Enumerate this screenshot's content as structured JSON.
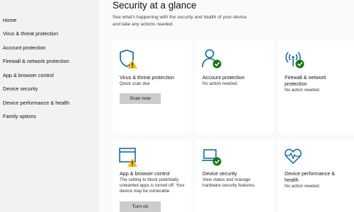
{
  "sidebar": {
    "items": [
      {
        "label": "Home"
      },
      {
        "label": "Virus & threat protection"
      },
      {
        "label": "Account protection"
      },
      {
        "label": "Firewall & network protection"
      },
      {
        "label": "App & browser control"
      },
      {
        "label": "Device security"
      },
      {
        "label": "Device performance & health"
      },
      {
        "label": "Family options"
      }
    ]
  },
  "header": {
    "title": "Security at a glance",
    "subtitle": "See what's happening with the security and health of your device and take any actions needed."
  },
  "cards": [
    {
      "title": "Virus & threat protection",
      "desc": "Quick scan due",
      "button": "Scan now",
      "icon": "shield-warning-icon",
      "status": "warning"
    },
    {
      "title": "Account protection",
      "desc": "No action needed.",
      "icon": "person-check-icon",
      "status": "ok"
    },
    {
      "title": "Firewall & network protection",
      "desc": "No action needed.",
      "icon": "antenna-check-icon",
      "status": "ok"
    },
    {
      "title": "App & browser control",
      "desc": "The setting to block potentially unwanted apps is turned off. Your device may be vulnerable.",
      "button": "Turn on",
      "icon": "browser-warning-icon",
      "status": "warning"
    },
    {
      "title": "Device security",
      "desc": "View status and manage hardware security features.",
      "icon": "laptop-check-icon",
      "status": "ok"
    },
    {
      "title": "Device performance & health",
      "desc": "No action needed.",
      "icon": "heart-pulse-icon",
      "status": "ok"
    }
  ],
  "colors": {
    "accent": "#0063b1",
    "ok": "#107c10",
    "warning": "#ffb900",
    "sidebar_bg": "#f2f2f2",
    "button_bg": "#cccccc"
  }
}
